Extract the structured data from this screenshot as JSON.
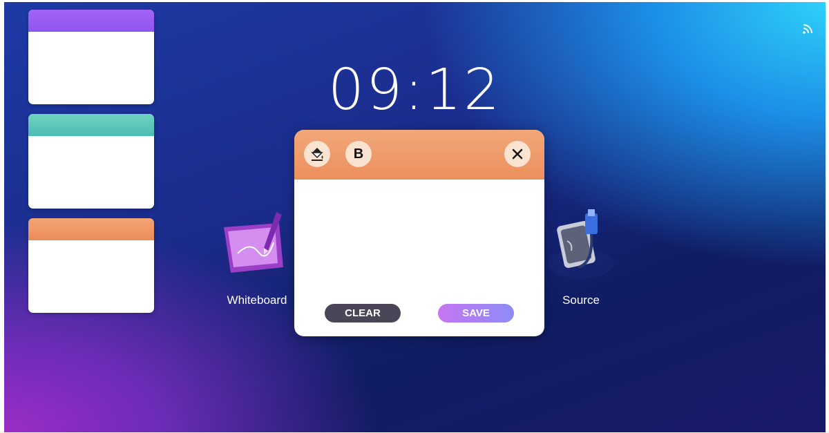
{
  "clock": {
    "time": "09:12"
  },
  "status": {
    "icon": "rss-icon"
  },
  "cards": [
    {
      "name": "card-purple",
      "header_color": "#9d5cf3"
    },
    {
      "name": "card-teal",
      "header_color": "#57c9b9"
    },
    {
      "name": "card-orange",
      "header_color": "#ef9761"
    }
  ],
  "apps": {
    "whiteboard": {
      "label": "Whiteboard",
      "icon": "whiteboard-icon"
    },
    "source": {
      "label": "Source",
      "icon": "source-icon"
    }
  },
  "dialog": {
    "tools": [
      {
        "icon": "paint-bucket-icon"
      },
      {
        "label": "B",
        "icon": "bold-icon"
      }
    ],
    "close_icon": "close-icon",
    "clear_label": "CLEAR",
    "save_label": "SAVE"
  },
  "colors": {
    "dialog_header": "#ee9764",
    "clear_button": "#4a4658",
    "save_button_start": "#c175f1",
    "save_button_end": "#8b8af5"
  }
}
